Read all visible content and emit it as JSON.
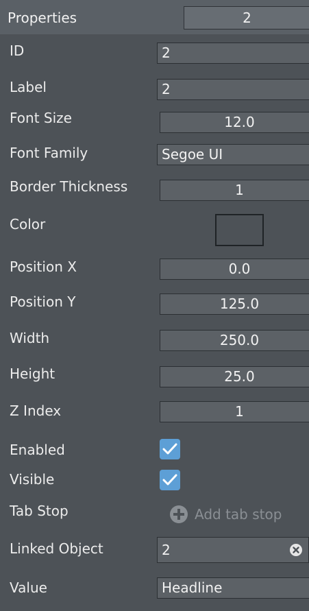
{
  "header": {
    "title": "Properties",
    "value": "2"
  },
  "fields": {
    "id": {
      "label": "ID",
      "value": "2"
    },
    "label": {
      "label": "Label",
      "value": "2"
    },
    "font_size": {
      "label": "Font Size",
      "value": "12.0"
    },
    "font_family": {
      "label": "Font Family",
      "value": "Segoe UI"
    },
    "border_thickness": {
      "label": "Border Thickness",
      "value": "1"
    },
    "color": {
      "label": "Color",
      "swatch_color": "#4d5257"
    },
    "position_x": {
      "label": "Position X",
      "value": "0.0"
    },
    "position_y": {
      "label": "Position Y",
      "value": "125.0"
    },
    "width": {
      "label": "Width",
      "value": "250.0"
    },
    "height": {
      "label": "Height",
      "value": "25.0"
    },
    "z_index": {
      "label": "Z Index",
      "value": "1"
    },
    "enabled": {
      "label": "Enabled",
      "checked": true
    },
    "visible": {
      "label": "Visible",
      "checked": true
    },
    "tab_stop": {
      "label": "Tab Stop",
      "action_label": "Add tab stop",
      "icon": "plus-circle-icon"
    },
    "linked_object": {
      "label": "Linked Object",
      "value": "2",
      "clear_icon": "clear-x-icon"
    },
    "value": {
      "label": "Value",
      "value": "Headline"
    }
  },
  "colors": {
    "panel_bg": "#4d5257",
    "header_bg": "#5a6066",
    "field_bg": "#5c6166",
    "checkbox_accent": "#5d9fd6",
    "disabled_text": "#8a8f94"
  }
}
